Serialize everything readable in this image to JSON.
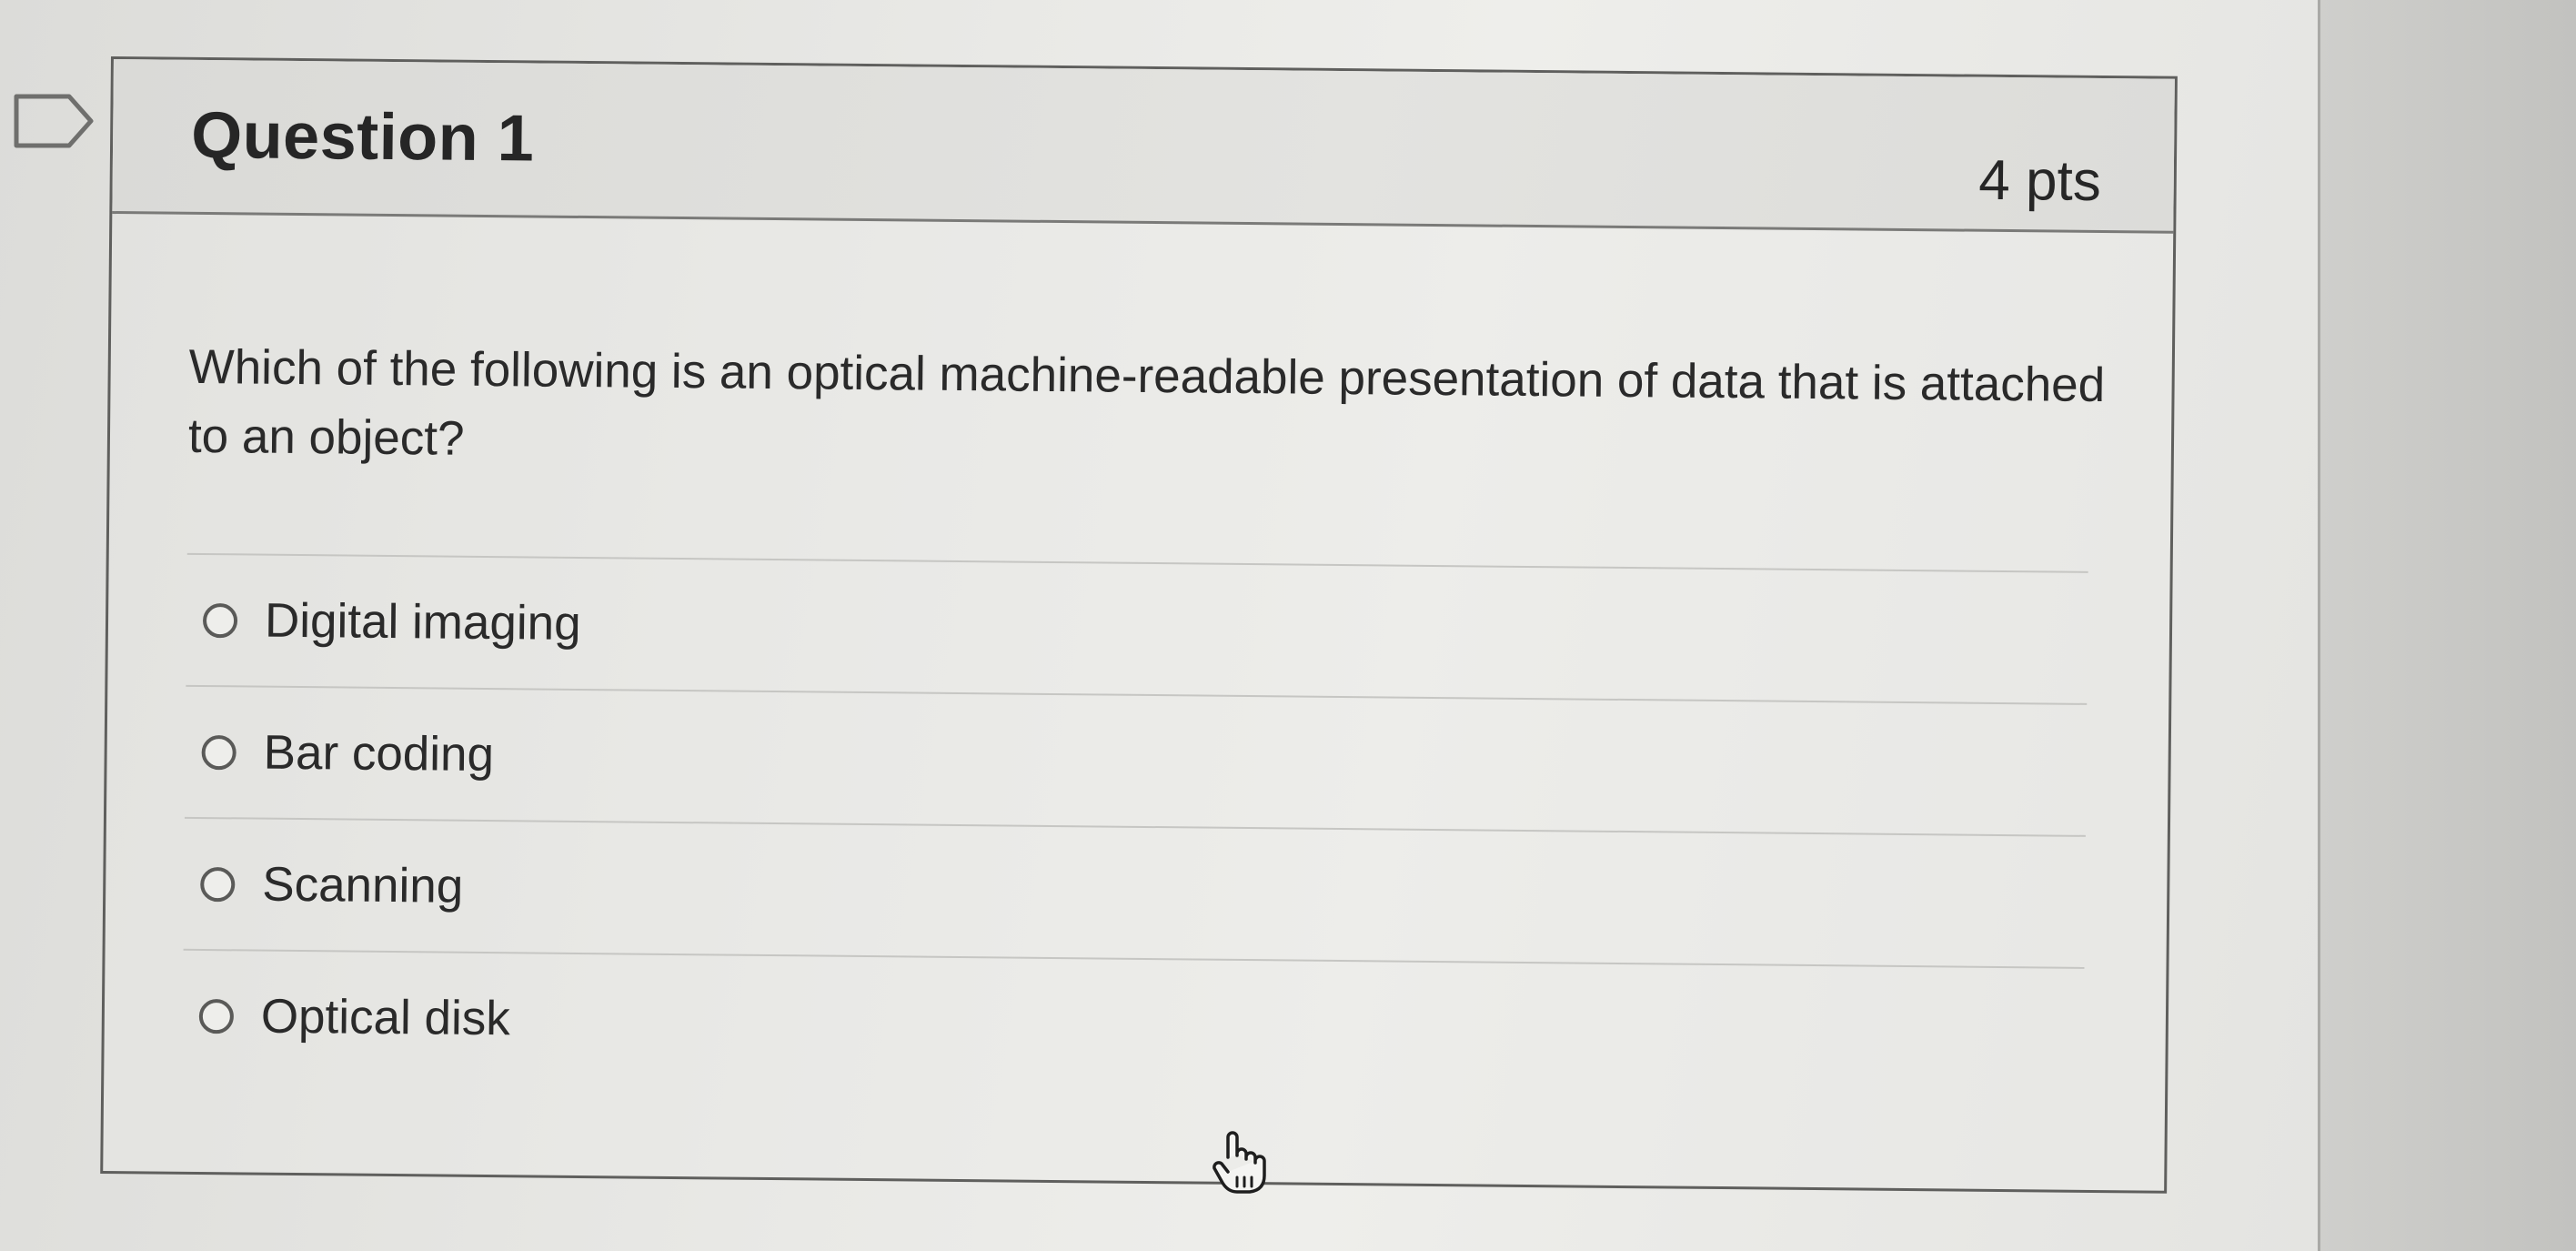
{
  "question": {
    "title": "Question 1",
    "points": "4 pts",
    "text": "Which of the following is an optical machine-readable presentation of data that is attached to an object?",
    "options": [
      {
        "label": "Digital imaging",
        "selected": false
      },
      {
        "label": "Bar coding",
        "selected": false
      },
      {
        "label": "Scanning",
        "selected": false
      },
      {
        "label": "Optical disk",
        "selected": false
      }
    ]
  },
  "icons": {
    "bookmark": "bookmark-flag-icon",
    "cursor": "hand-pointer-icon",
    "radio": "radio-unchecked-icon"
  },
  "colors": {
    "text": "#262626",
    "border": "#5f5f5d",
    "header_bg": "#e0e0dd",
    "page_bg": "#e9e9e6"
  }
}
